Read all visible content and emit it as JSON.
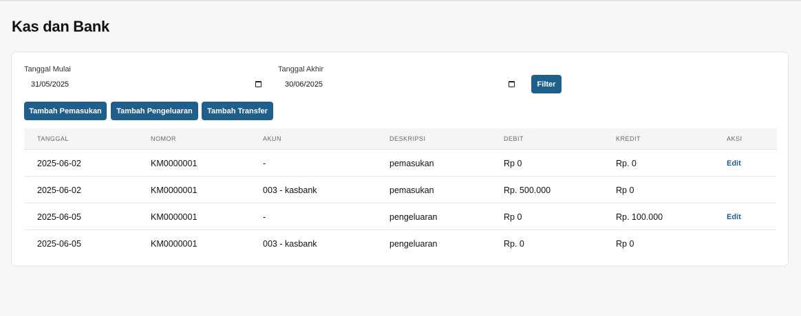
{
  "page": {
    "title": "Kas dan Bank"
  },
  "filter": {
    "start_label": "Tanggal Mulai",
    "start_value": "31/05/2025",
    "end_label": "Tanggal Akhir",
    "end_value": "30/06/2025",
    "filter_button": "Filter"
  },
  "actions": {
    "add_income": "Tambah Pemasukan",
    "add_expense": "Tambah Pengeluaran",
    "add_transfer": "Tambah Transfer"
  },
  "table": {
    "headers": [
      "TANGGAL",
      "NOMOR",
      "AKUN",
      "DESKRIPSI",
      "DEBIT",
      "KREDIT",
      "AKSI"
    ],
    "rows": [
      {
        "tanggal": "2025-06-02",
        "nomor": "KM0000001",
        "akun": "-",
        "deskripsi": "pemasukan",
        "debit": "Rp 0",
        "kredit": "Rp. 0",
        "aksi": "Edit"
      },
      {
        "tanggal": "2025-06-02",
        "nomor": "KM0000001",
        "akun": "003 - kasbank",
        "deskripsi": "pemasukan",
        "debit": "Rp. 500.000",
        "kredit": "Rp 0",
        "aksi": ""
      },
      {
        "tanggal": "2025-06-05",
        "nomor": "KM0000001",
        "akun": "-",
        "deskripsi": "pengeluaran",
        "debit": "Rp 0",
        "kredit": "Rp. 100.000",
        "aksi": "Edit"
      },
      {
        "tanggal": "2025-06-05",
        "nomor": "KM0000001",
        "akun": "003 - kasbank",
        "deskripsi": "pengeluaran",
        "debit": "Rp. 0",
        "kredit": "Rp 0",
        "aksi": ""
      }
    ]
  },
  "colors": {
    "primary": "#1f5f8b",
    "background": "#f7f7f7",
    "card": "#ffffff"
  },
  "icons": {
    "date_picker": "calendar-icon"
  }
}
